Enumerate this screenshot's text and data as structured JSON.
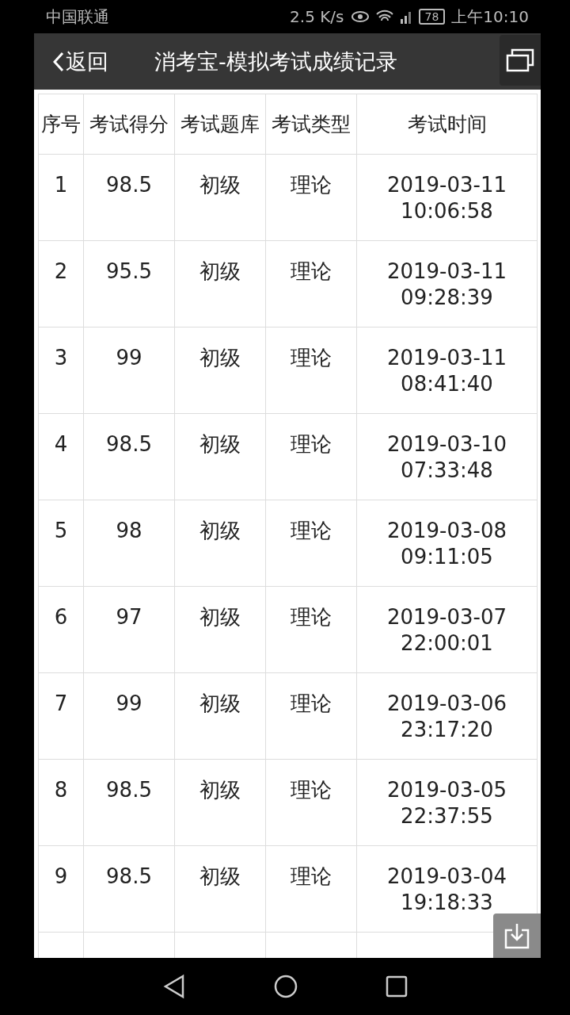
{
  "status_bar": {
    "carrier": "中国联通",
    "speed": "2.5 K/s",
    "battery": "78",
    "time": "上午10:10"
  },
  "header": {
    "back": "返回",
    "title": "消考宝-模拟考试成绩记录"
  },
  "table": {
    "columns": [
      "序号",
      "考试得分",
      "考试题库",
      "考试类型",
      "考试时间"
    ],
    "rows": [
      {
        "no": "1",
        "score": "98.5",
        "bank": "初级",
        "type": "理论",
        "date": "2019-03-11",
        "time": "10:06:58"
      },
      {
        "no": "2",
        "score": "95.5",
        "bank": "初级",
        "type": "理论",
        "date": "2019-03-11",
        "time": "09:28:39"
      },
      {
        "no": "3",
        "score": "99",
        "bank": "初级",
        "type": "理论",
        "date": "2019-03-11",
        "time": "08:41:40"
      },
      {
        "no": "4",
        "score": "98.5",
        "bank": "初级",
        "type": "理论",
        "date": "2019-03-10",
        "time": "07:33:48"
      },
      {
        "no": "5",
        "score": "98",
        "bank": "初级",
        "type": "理论",
        "date": "2019-03-08",
        "time": "09:11:05"
      },
      {
        "no": "6",
        "score": "97",
        "bank": "初级",
        "type": "理论",
        "date": "2019-03-07",
        "time": "22:00:01"
      },
      {
        "no": "7",
        "score": "99",
        "bank": "初级",
        "type": "理论",
        "date": "2019-03-06",
        "time": "23:17:20"
      },
      {
        "no": "8",
        "score": "98.5",
        "bank": "初级",
        "type": "理论",
        "date": "2019-03-05",
        "time": "22:37:55"
      },
      {
        "no": "9",
        "score": "98.5",
        "bank": "初级",
        "type": "理论",
        "date": "2019-03-04",
        "time": "19:18:33"
      }
    ]
  }
}
